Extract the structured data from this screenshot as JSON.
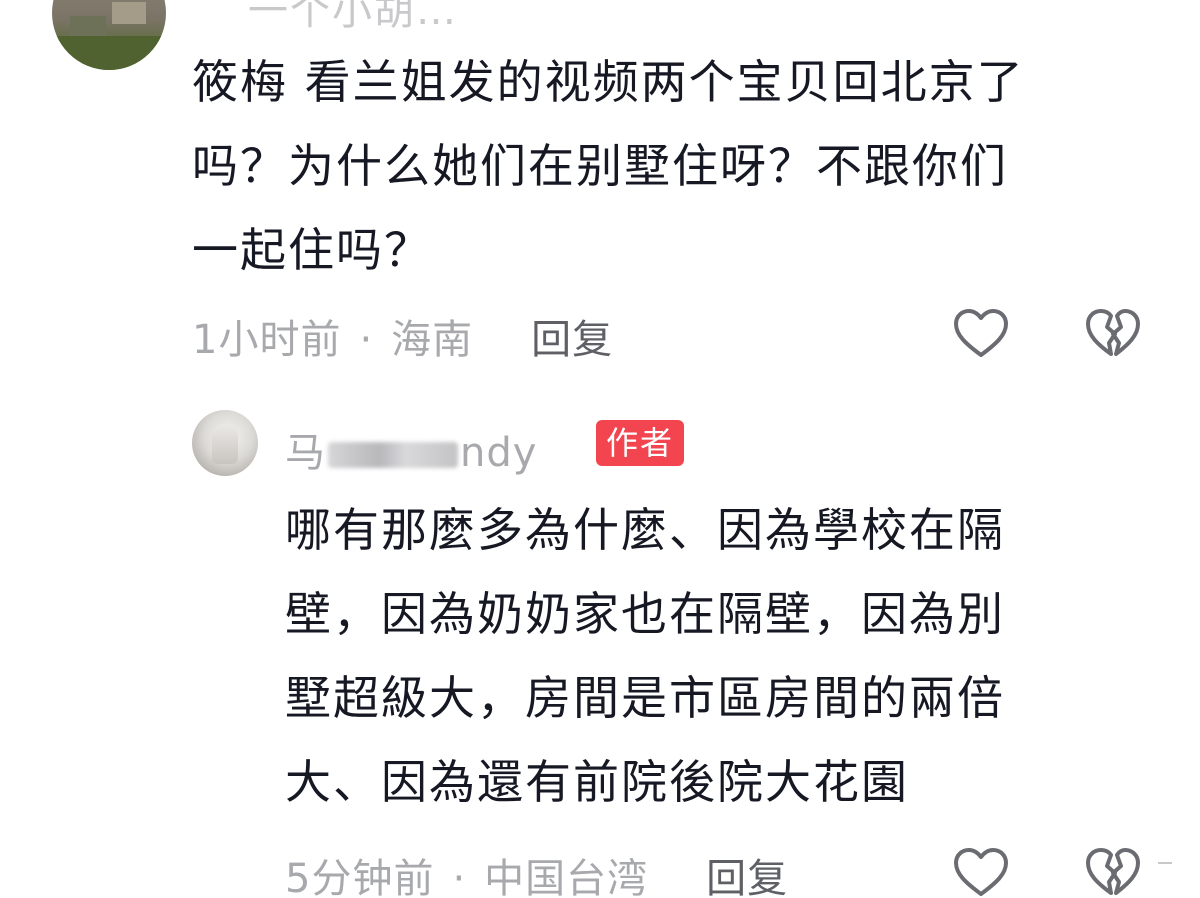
{
  "top_comment": {
    "username_partial": "一个小胡…",
    "text_lines": [
      "筱梅 看兰姐发的视频两个宝贝回北京了",
      "吗？为什么她们在别墅住呀？不跟你们",
      "一起住吗？"
    ],
    "time": "1小时前",
    "separator": "·",
    "location": "海南",
    "reply_label": "回复"
  },
  "author_reply": {
    "username": "马筱梅 Mandy",
    "username_visible_start": "马",
    "username_visible_end": "ndy",
    "badge": "作者",
    "text_lines": [
      "哪有那麼多為什麼、因為學校在隔",
      "壁，因為奶奶家也在隔壁，因為別",
      "墅超級大，房間是市區房間的兩倍",
      "大、因為還有前院後院大花園"
    ],
    "time": "5分钟前",
    "separator": "·",
    "location": "中国台湾",
    "reply_label": "回复"
  },
  "icons": {
    "like": "heart-outline-icon",
    "dislike": "broken-heart-icon"
  },
  "colors": {
    "text": "#161823",
    "meta": "#a8a9ad",
    "reply_label": "#5f6066",
    "badge_bg": "#f2454f"
  }
}
